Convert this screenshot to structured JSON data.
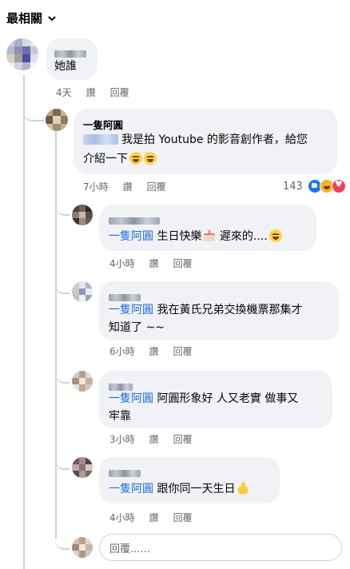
{
  "sort_label": "最相關",
  "comments": [
    {
      "id": "c1",
      "text": "她誰",
      "time": "4天",
      "like_label": "讚",
      "reply_label": "回覆"
    },
    {
      "id": "c2",
      "author": "一隻阿圓",
      "text_line1": "我是拍 Youtube 的影音創作者，給您",
      "text_line2": "介紹一下",
      "time": "7小時",
      "like_label": "讚",
      "reply_label": "回覆",
      "reaction_count": "143"
    }
  ],
  "replies": [
    {
      "id": "r1",
      "mention": "一隻阿圓",
      "text_line1": "生日快樂",
      "text_line1b": "遲來的....",
      "time": "4小時",
      "like_label": "讚",
      "reply_label": "回覆"
    },
    {
      "id": "r2",
      "mention": "一隻阿圓",
      "text_line1": "我在黃氏兄弟交換機票那集才",
      "text_line2": "知道了 ~~",
      "time": "6小時",
      "like_label": "讚",
      "reply_label": "回覆"
    },
    {
      "id": "r3",
      "mention": "一隻阿圓",
      "text_line1": "阿圓形象好 人又老實 做事又",
      "text_line2": "牢靠",
      "time": "3小時",
      "like_label": "讚",
      "reply_label": "回覆"
    },
    {
      "id": "r4",
      "mention": "一隻阿圓",
      "text_line1": "跟你同一天生日",
      "time": "4小時",
      "like_label": "讚",
      "reply_label": "回覆"
    }
  ],
  "reply_input": {
    "placeholder": "回覆......"
  },
  "icons": {
    "sort": "chevron-down-icon",
    "reactions": [
      "like-reaction-icon",
      "haha-reaction-icon",
      "love-reaction-icon"
    ],
    "emoji": [
      "laughing-emoji-icon",
      "birthday-cake-emoji-icon",
      "thumbs-up-emoji-icon"
    ]
  },
  "colors": {
    "mention": "#216fdb",
    "bubble": "#f0f2f5",
    "meta": "#65676b"
  }
}
